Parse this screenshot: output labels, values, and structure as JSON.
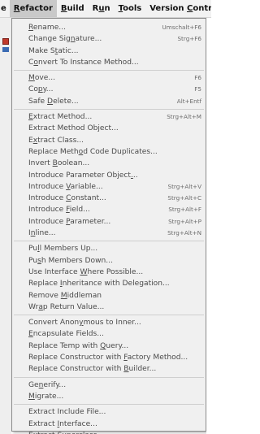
{
  "menubar": {
    "items": [
      {
        "label": "e",
        "mnemonic_index": -1
      },
      {
        "label": "Refactor",
        "mnemonic_index": 0,
        "active": true
      },
      {
        "label": "Build",
        "mnemonic_index": 0
      },
      {
        "label": "Run",
        "mnemonic_index": 1
      },
      {
        "label": "Tools",
        "mnemonic_index": 0
      },
      {
        "label": "Version Control",
        "mnemonic_index": 8
      },
      {
        "label": "V",
        "mnemonic_index": -1
      }
    ]
  },
  "menu": {
    "groups": [
      [
        {
          "label": "Rename...",
          "mnemonic_index": 0,
          "shortcut": "Umschalt+F6"
        },
        {
          "label": "Change Signature...",
          "mnemonic_index": 10,
          "shortcut": "Strg+F6"
        },
        {
          "label": "Make Static...",
          "mnemonic_index": 6,
          "shortcut": ""
        },
        {
          "label": "Convert To Instance Method...",
          "mnemonic_index": 1,
          "shortcut": ""
        }
      ],
      [
        {
          "label": "Move...",
          "mnemonic_index": 0,
          "shortcut": "F6"
        },
        {
          "label": "Copy...",
          "mnemonic_index": 2,
          "shortcut": "F5"
        },
        {
          "label": "Safe Delete...",
          "mnemonic_index": 5,
          "shortcut": "Alt+Entf"
        }
      ],
      [
        {
          "label": "Extract Method...",
          "mnemonic_index": 0,
          "shortcut": "Strg+Alt+M"
        },
        {
          "label": "Extract Method Object...",
          "mnemonic_index": -1,
          "shortcut": ""
        },
        {
          "label": "Extract Class...",
          "mnemonic_index": 1,
          "shortcut": ""
        },
        {
          "label": "Replace Method Code Duplicates...",
          "mnemonic_index": 12,
          "shortcut": ""
        },
        {
          "label": "Invert Boolean...",
          "mnemonic_index": 7,
          "shortcut": ""
        },
        {
          "label": "Introduce Parameter Object...",
          "mnemonic_index": 26,
          "shortcut": ""
        },
        {
          "label": "Introduce Variable...",
          "mnemonic_index": 10,
          "shortcut": "Strg+Alt+V"
        },
        {
          "label": "Introduce Constant...",
          "mnemonic_index": 10,
          "shortcut": "Strg+Alt+C"
        },
        {
          "label": "Introduce Field...",
          "mnemonic_index": 10,
          "shortcut": "Strg+Alt+F"
        },
        {
          "label": "Introduce Parameter...",
          "mnemonic_index": 10,
          "shortcut": "Strg+Alt+P"
        },
        {
          "label": "Inline...",
          "mnemonic_index": 1,
          "shortcut": "Strg+Alt+N"
        }
      ],
      [
        {
          "label": "Pull Members Up...",
          "mnemonic_index": 2,
          "shortcut": ""
        },
        {
          "label": "Push Members Down...",
          "mnemonic_index": 2,
          "shortcut": ""
        },
        {
          "label": "Use Interface Where Possible...",
          "mnemonic_index": 14,
          "shortcut": ""
        },
        {
          "label": "Replace Inheritance with Delegation...",
          "mnemonic_index": 8,
          "shortcut": ""
        },
        {
          "label": "Remove Middleman",
          "mnemonic_index": 7,
          "shortcut": ""
        },
        {
          "label": "Wrap Return Value...",
          "mnemonic_index": 2,
          "shortcut": ""
        }
      ],
      [
        {
          "label": "Convert Anonymous to Inner...",
          "mnemonic_index": 12,
          "shortcut": ""
        },
        {
          "label": "Encapsulate Fields...",
          "mnemonic_index": 0,
          "shortcut": ""
        },
        {
          "label": "Replace Temp with Query...",
          "mnemonic_index": 18,
          "shortcut": ""
        },
        {
          "label": "Replace Constructor with Factory Method...",
          "mnemonic_index": 25,
          "shortcut": ""
        },
        {
          "label": "Replace Constructor with Builder...",
          "mnemonic_index": 25,
          "shortcut": ""
        }
      ],
      [
        {
          "label": "Generify...",
          "mnemonic_index": 2,
          "shortcut": ""
        },
        {
          "label": "Migrate...",
          "mnemonic_index": 0,
          "shortcut": ""
        }
      ],
      [
        {
          "label": "Extract Include File...",
          "mnemonic_index": -1,
          "shortcut": ""
        },
        {
          "label": "Extract Interface...",
          "mnemonic_index": 8,
          "shortcut": ""
        },
        {
          "label": "Extract Superclass...",
          "mnemonic_index": 9,
          "shortcut": ""
        }
      ]
    ]
  }
}
